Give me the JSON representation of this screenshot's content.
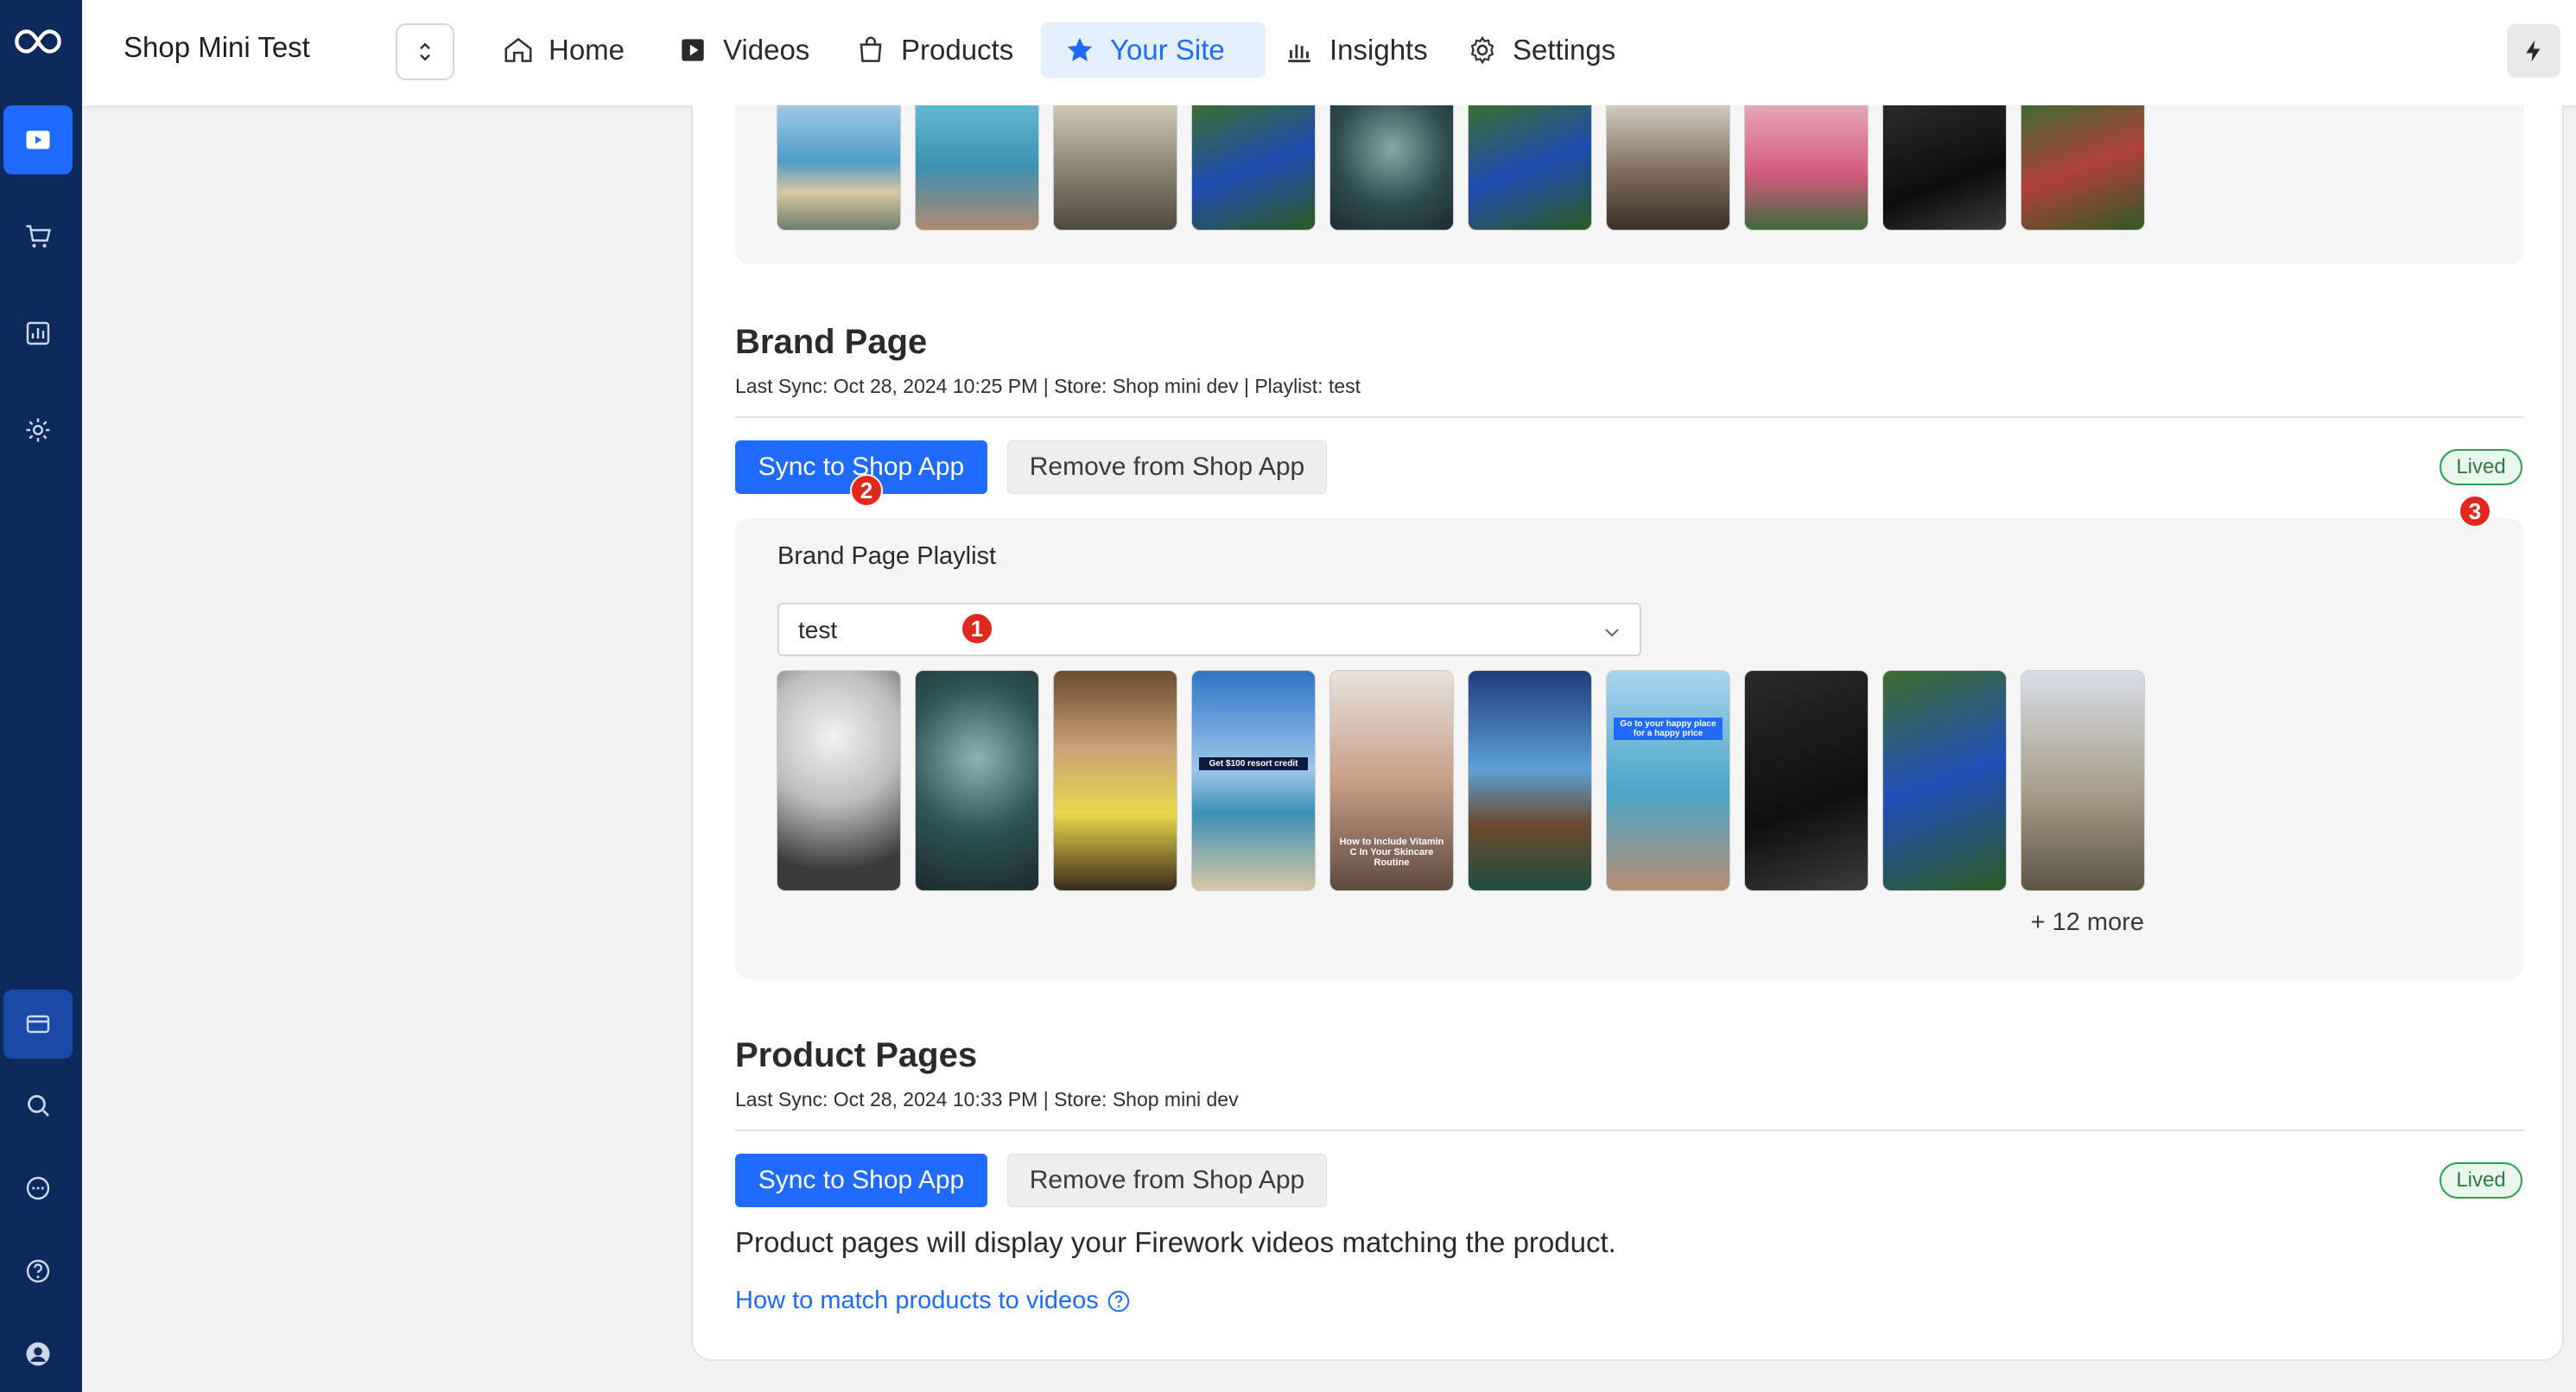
{
  "header": {
    "app_title": "Shop Mini Test",
    "nav": [
      {
        "label": "Home",
        "icon": "home-icon"
      },
      {
        "label": "Videos",
        "icon": "video-icon"
      },
      {
        "label": "Products",
        "icon": "bag-icon"
      },
      {
        "label": "Your Site",
        "icon": "star-icon",
        "active": true
      },
      {
        "label": "Insights",
        "icon": "chart-icon"
      },
      {
        "label": "Settings",
        "icon": "gear-icon"
      }
    ]
  },
  "colors": {
    "brand_blue": "#1f6bff",
    "rail_navy": "#0e2a5c",
    "lived_green": "#2e9d4d",
    "marker_red": "#e0281f"
  },
  "brand_page": {
    "title": "Brand Page",
    "meta": "Last Sync: Oct 28, 2024 10:25 PM | Store: Shop mini dev | Playlist: test",
    "sync_label": "Sync to Shop App",
    "remove_label": "Remove from Shop App",
    "status": "Lived",
    "playlist_label": "Brand Page Playlist",
    "playlist_value": "test",
    "more": "+ 12 more"
  },
  "product_pages": {
    "title": "Product Pages",
    "meta": "Last Sync: Oct 28, 2024 10:33 PM | Store: Shop mini dev",
    "sync_label": "Sync to Shop App",
    "remove_label": "Remove from Shop App",
    "status": "Lived",
    "description": "Product pages will display your Firework videos matching the product.",
    "help_link": "How to match products to videos"
  },
  "markers": [
    "1",
    "2",
    "3"
  ],
  "thumbnail_text": {
    "resort_credit": "Get $100 resort credit",
    "vitamin": "How to Include Vitamin C In Your Skincare Routine",
    "happy_place": "Go to your happy place for a happy price"
  }
}
